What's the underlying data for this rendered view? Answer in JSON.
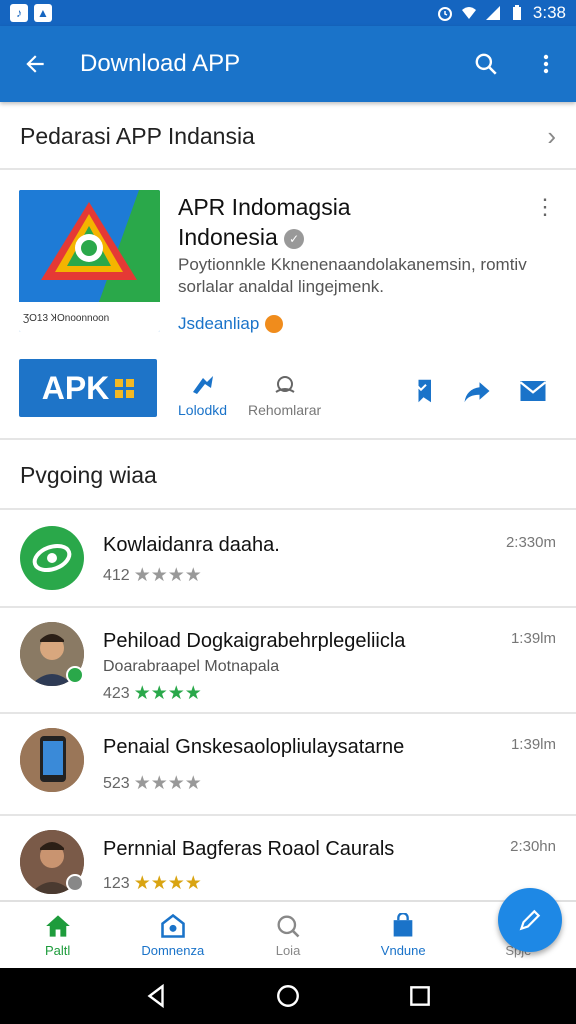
{
  "status_bar": {
    "time": "3:38",
    "icons": [
      "notification-icon",
      "image-icon",
      "alarm-icon",
      "wifi-icon",
      "signal-icon",
      "battery-icon"
    ]
  },
  "app_bar": {
    "title": "Download APP",
    "icons": [
      "back-arrow-icon",
      "search-icon",
      "more-vert-icon"
    ]
  },
  "category": {
    "label": "Pedarasi APP Indansia"
  },
  "app": {
    "title_line1": "APR Indomagsia",
    "title_line2": "Indonesia",
    "icon_caption": "ƷO13 ꞰOnoonnoon",
    "description": "Poytionnkle Kknenenaandolakanemsin, romtiv sorlalar analdal lingejmenk.",
    "developer": "Jsdeanliap",
    "apk_label": "APK",
    "actions": [
      {
        "label": "Lolodkd",
        "icon": "download-icon"
      },
      {
        "label": "Rehomlarar",
        "icon": "reviews-icon"
      }
    ],
    "share_icons": [
      "bookmark-icon",
      "share-icon",
      "mail-icon"
    ],
    "accent": "#1a73c9"
  },
  "section": {
    "title": "Pvgoing wiaa"
  },
  "list": [
    {
      "title": "Kowlaidanra daaha.",
      "subtitle": "",
      "rating": "412",
      "stars": "★★★★",
      "time": "2:330m",
      "avatar": "green-logo"
    },
    {
      "title": "Pehiload Dogkaigrabehrplegeliicla",
      "subtitle": "Doarabraapel Motnapala",
      "rating": "423",
      "stars": "★★★★",
      "time": "1:39lm",
      "avatar": "person"
    },
    {
      "title": "Penaial Gnskesaolopliulaysatarne",
      "subtitle": "",
      "rating": "523",
      "stars": "★★★★",
      "time": "1:39lm",
      "avatar": "phone"
    },
    {
      "title": "Pernnial Bagferas Roaol Caurals",
      "subtitle": "",
      "rating": "123",
      "stars": "★★★★",
      "time": "2:30hn",
      "avatar": "person2"
    }
  ],
  "bottom_nav": [
    {
      "label": "Paltl",
      "icon": "home-icon",
      "color": "#1e9c3c"
    },
    {
      "label": "Domnenza",
      "icon": "store-icon",
      "color": "#1a73c9"
    },
    {
      "label": "Loia",
      "icon": "search-icon",
      "color": "#888888"
    },
    {
      "label": "Vndune",
      "icon": "bag-icon",
      "color": "#1a73c9"
    },
    {
      "label": "Spje",
      "icon": "apps-icon",
      "color": "#888888"
    }
  ],
  "fab": {
    "icon": "edit-icon"
  },
  "system_nav": [
    "back-icon",
    "home-circle-icon",
    "recents-icon"
  ]
}
